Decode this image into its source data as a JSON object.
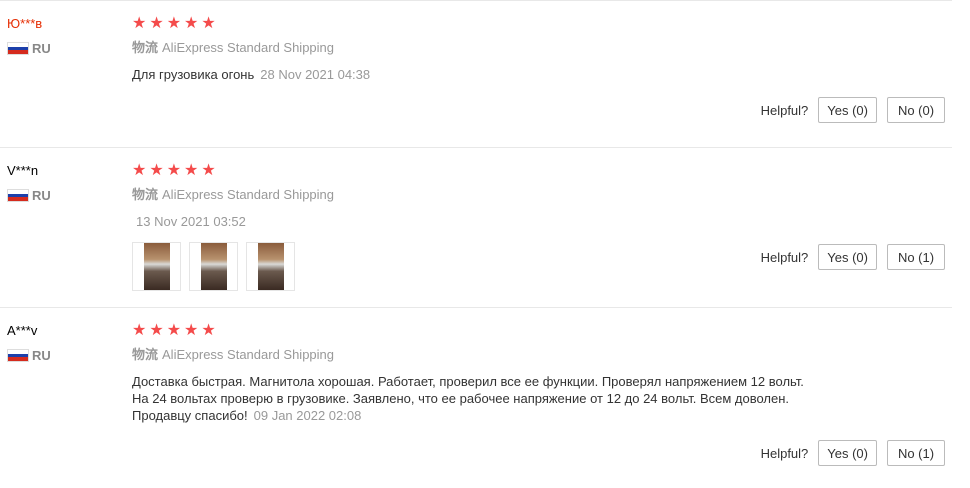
{
  "colors": {
    "star": "#f44b4b",
    "highlight_name": "#e62e04",
    "muted": "#999999"
  },
  "reviews": [
    {
      "user": "Ю***в",
      "country": "RU",
      "stars": 5,
      "shipping_label": "物流",
      "shipping": "AliExpress Standard Shipping",
      "text": "Для грузовика огонь",
      "date": "28 Nov 2021 04:38",
      "helpful_label": "Helpful?",
      "yes": "Yes (0)",
      "no": "No (0)"
    },
    {
      "user": "V***n",
      "country": "RU",
      "stars": 5,
      "shipping_label": "物流",
      "shipping": "AliExpress Standard Shipping",
      "text": "",
      "date": "13 Nov 2021 03:52",
      "photo_count": 3,
      "helpful_label": "Helpful?",
      "yes": "Yes (0)",
      "no": "No (1)"
    },
    {
      "user": "A***v",
      "country": "RU",
      "stars": 5,
      "shipping_label": "物流",
      "shipping": "AliExpress Standard Shipping",
      "text_lines": [
        "Доставка быстрая. Магнитола хорошая. Работает, проверил все ее функции. Проверял напряжением 12 вольт.",
        "На 24 вольтах проверю в грузовике. Заявлено, что ее рабочее напряжение от 12 до 24 вольт. Всем доволен.",
        "Продавцу спасибо!"
      ],
      "date": "09 Jan 2022 02:08",
      "helpful_label": "Helpful?",
      "yes": "Yes (0)",
      "no": "No (1)"
    }
  ]
}
